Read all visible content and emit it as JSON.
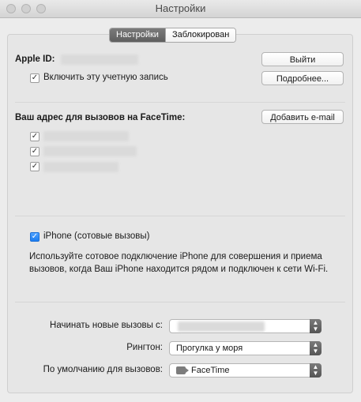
{
  "window": {
    "title": "Настройки"
  },
  "tabs": [
    {
      "label": "Настройки",
      "selected": true
    },
    {
      "label": "Заблокирован",
      "selected": false
    }
  ],
  "account": {
    "apple_id_label": "Apple ID:",
    "enable_label": "Включить эту учетную запись",
    "enable_checked": true,
    "signout_button": "Выйти",
    "details_button": "Подробнее..."
  },
  "facetime": {
    "address_label": "Ваш адрес для вызовов на FaceTime:",
    "add_email_button": "Добавить e-mail",
    "addresses": [
      {
        "checked": true
      },
      {
        "checked": true
      },
      {
        "checked": true
      }
    ]
  },
  "iphone": {
    "label": "iPhone (сотовые вызовы)",
    "checked": true,
    "description": "Используйте сотовое подключение iPhone для совершения и приема вызовов, когда Ваш iPhone находится рядом и подключен к сети Wi-Fi."
  },
  "settings": {
    "start_calls_label": "Начинать новые вызовы с:",
    "ringtone_label": "Рингтон:",
    "ringtone_value": "Прогулка у моря",
    "default_label": "По умолчанию для вызовов:",
    "default_value": "FaceTime"
  },
  "colors": {
    "accent": "#1c7df0",
    "selected_tab": "#6a6a6a"
  }
}
